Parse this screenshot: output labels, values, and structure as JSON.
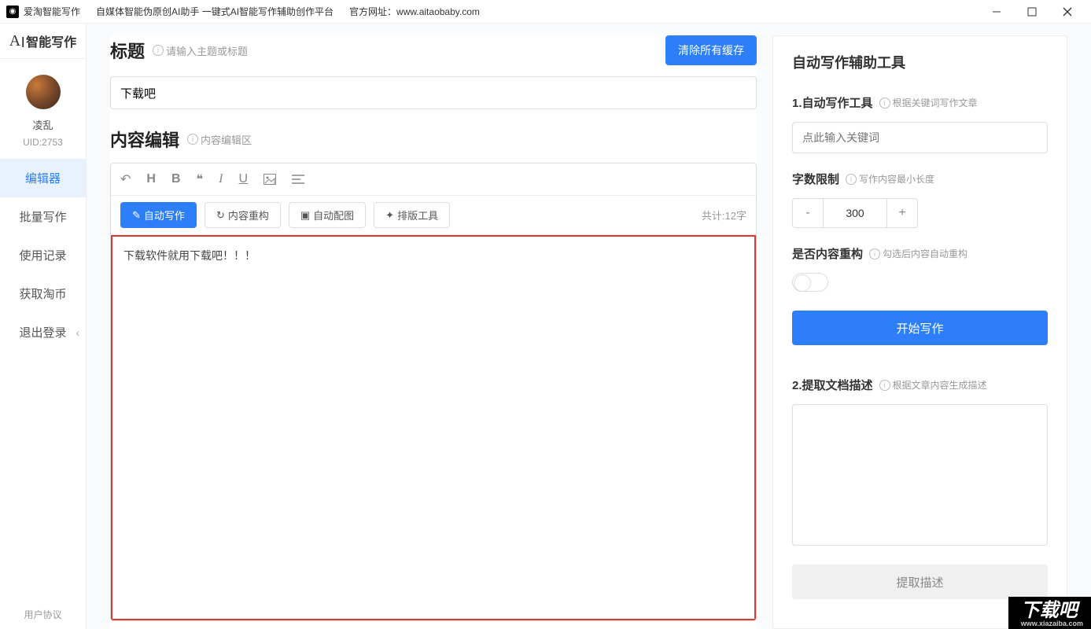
{
  "titlebar": {
    "app_name": "爱淘智能写作",
    "subtitle": "自媒体智能伪原创AI助手    一键式AI智能写作辅助创作平台",
    "site_label": "官方网址：",
    "site_url": "www.aitaobaby.com"
  },
  "sidebar": {
    "logo_text": "智能写作",
    "username": "凌乱",
    "uid": "UID:2753",
    "items": [
      {
        "label": "编辑器",
        "active": true
      },
      {
        "label": "批量写作",
        "active": false
      },
      {
        "label": "使用记录",
        "active": false
      },
      {
        "label": "获取淘币",
        "active": false
      },
      {
        "label": "退出登录",
        "active": false
      }
    ],
    "footer": "用户协议"
  },
  "editor": {
    "title_section": "标题",
    "title_hint": "请输入主题或标题",
    "clear_cache": "清除所有缓存",
    "title_value": "下载吧",
    "content_section": "内容编辑",
    "content_hint": "内容编辑区",
    "actions": {
      "auto_write": "自动写作",
      "restructure": "内容重构",
      "auto_image": "自动配图",
      "layout_tool": "排版工具"
    },
    "count_label": "共计:12字",
    "textarea_value": "下载软件就用下载吧！！！"
  },
  "panel": {
    "title": "自动写作辅助工具",
    "tool1_title": "1.自动写作工具",
    "tool1_hint": "根据关键词写作文章",
    "keyword_placeholder": "点此输入关键词",
    "limit_title": "字数限制",
    "limit_hint": "写作内容最小长度",
    "limit_value": "300",
    "restructure_title": "是否内容重构",
    "restructure_hint": "勾选后内容自动重构",
    "start_btn": "开始写作",
    "tool2_title": "2.提取文档描述",
    "tool2_hint": "根据文章内容生成描述",
    "extract_btn": "提取描述"
  },
  "watermark": {
    "text": "下载吧",
    "url": "www.xiazaiba.com"
  }
}
